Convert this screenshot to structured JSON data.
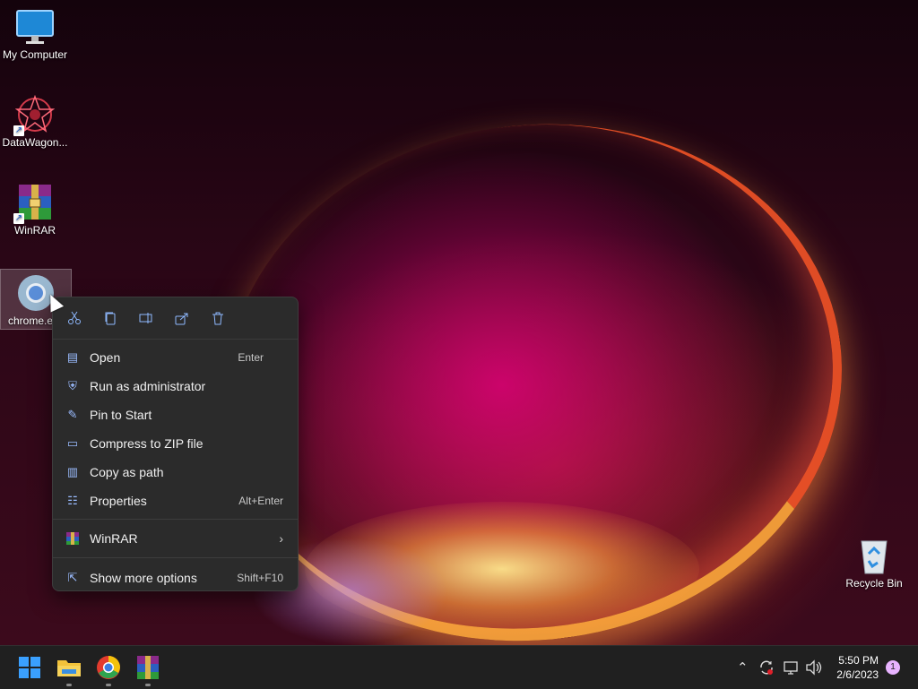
{
  "desktop": {
    "icons": [
      {
        "label": "My Computer",
        "icon": "monitor-icon"
      },
      {
        "label": "DataWagon...",
        "icon": "datawagon-icon"
      },
      {
        "label": "WinRAR",
        "icon": "winrar-icon"
      },
      {
        "label": "chrome.e",
        "icon": "chrome-icon"
      },
      {
        "label": "Recycle Bin",
        "icon": "recycle-bin-icon"
      }
    ]
  },
  "context_menu": {
    "toolbar": [
      "cut-icon",
      "copy-icon",
      "rename-icon",
      "share-icon",
      "delete-icon"
    ],
    "items": [
      {
        "label": "Open",
        "shortcut": "Enter",
        "icon": "open-icon"
      },
      {
        "label": "Run as administrator",
        "shortcut": "",
        "icon": "admin-shield-icon"
      },
      {
        "label": "Pin to Start",
        "shortcut": "",
        "icon": "pin-icon"
      },
      {
        "label": "Compress to ZIP file",
        "shortcut": "",
        "icon": "zip-folder-icon"
      },
      {
        "label": "Copy as path",
        "shortcut": "",
        "icon": "copy-path-icon"
      },
      {
        "label": "Properties",
        "shortcut": "Alt+Enter",
        "icon": "properties-icon"
      },
      {
        "label": "WinRAR",
        "shortcut": "",
        "icon": "winrar-icon"
      },
      {
        "label": "Show more options",
        "shortcut": "Shift+F10",
        "icon": "more-options-icon"
      }
    ]
  },
  "taskbar": {
    "apps": [
      "start-icon",
      "file-explorer-icon",
      "chrome-icon",
      "winrar-icon"
    ],
    "tray": [
      "chevron-up-icon",
      "sync-icon",
      "network-icon",
      "volume-icon"
    ],
    "time": "5:50 PM",
    "date": "2/6/2023",
    "notifications": "1"
  },
  "colors": {
    "menu_bg": "#2b2b2b",
    "accent": "#8fb9ff",
    "taskbar_bg": "#202020"
  }
}
